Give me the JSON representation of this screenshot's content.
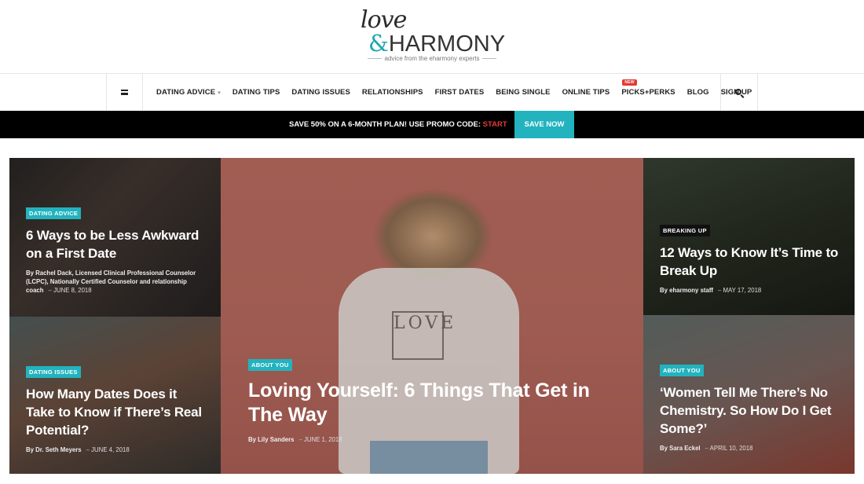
{
  "logo": {
    "love": "love",
    "amp": "&",
    "harmony": "HARMONY",
    "tagline": "advice from the eharmony experts"
  },
  "nav": {
    "items": [
      {
        "label": "DATING ADVICE",
        "has_caret": true
      },
      {
        "label": "DATING TIPS"
      },
      {
        "label": "DATING ISSUES"
      },
      {
        "label": "RELATIONSHIPS"
      },
      {
        "label": "FIRST DATES"
      },
      {
        "label": "BEING SINGLE"
      },
      {
        "label": "ONLINE TIPS"
      },
      {
        "label": "PICKS+PERKS",
        "badge": "NEW"
      },
      {
        "label": "BLOG"
      },
      {
        "label": "SIGN UP"
      }
    ],
    "menu_icon": "hamburger-icon",
    "search_icon": "search-icon"
  },
  "promo": {
    "text": "SAVE 50% ON A 6-MONTH PLAN! USE PROMO CODE: ",
    "code": "START",
    "button": "SAVE NOW"
  },
  "cards": [
    {
      "category": "DATING ADVICE",
      "title": "6 Ways to be Less Awkward on a First Date",
      "author": "By Rachel Dack, Licensed Clinical Professional Counselor (LCPC), Nationally Certified Counselor and relationship coach",
      "date": "JUNE 8, 2018"
    },
    {
      "category": "DATING ISSUES",
      "title": "How Many Dates Does it Take to Know if There’s Real Potential?",
      "author": "By Dr. Seth Meyers",
      "date": "JUNE 4, 2018"
    },
    {
      "category": "ABOUT YOU",
      "title": "Loving Yourself: 6 Things That Get in The Way",
      "author": "By Lily Sanders",
      "date": "JUNE 1, 2018"
    },
    {
      "category": "BREAKING UP",
      "title": "12 Ways to Know It’s Time to Break Up",
      "author": "By eharmony staff",
      "date": "MAY 17, 2018"
    },
    {
      "category": "ABOUT YOU",
      "title": "‘Women Tell Me There’s No Chemistry. So How Do I Get Some?’",
      "author": "By Sara Eckel",
      "date": "APRIL 10, 2018"
    }
  ],
  "sweater_text": "LOVE",
  "colors": {
    "accent": "#22b3be",
    "promo_code": "#e53935",
    "promo_bg": "#000000"
  }
}
